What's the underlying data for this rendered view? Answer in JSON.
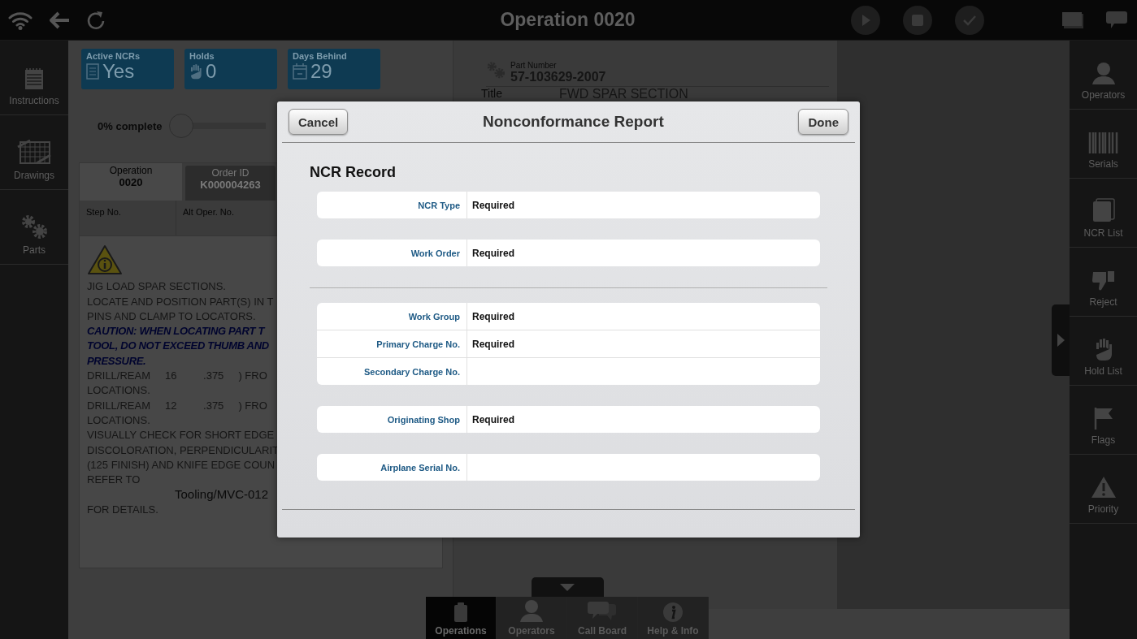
{
  "top_bar": {
    "title": "Operation 0020"
  },
  "left_nav": [
    {
      "label": "Instructions",
      "kind": "instructions"
    },
    {
      "label": "Drawings",
      "kind": "drawings"
    },
    {
      "label": "Parts",
      "kind": "parts"
    }
  ],
  "stats": [
    {
      "label": "Active NCRs",
      "value": "Yes",
      "kind": "ncr"
    },
    {
      "label": "Holds",
      "value": "0",
      "kind": "hold"
    },
    {
      "label": "Days Behind",
      "value": "29",
      "kind": "days"
    }
  ],
  "progress": {
    "label": "0% complete",
    "level": 0
  },
  "info_tabs": [
    {
      "label": "Operation",
      "value": "0020",
      "selected": true
    },
    {
      "label": "Order ID",
      "value": "K000004263",
      "selected": false
    }
  ],
  "info_fields": [
    "Step No.",
    "Alt Oper. No."
  ],
  "instructions": [
    {
      "text": "JIG LOAD SPAR SECTIONS.",
      "kind": "normal"
    },
    {
      "text": "LOCATE AND POSITION PART(S) IN T",
      "kind": "normal"
    },
    {
      "text": "PINS AND CLAMP TO LOCATORS.",
      "kind": "normal"
    },
    {
      "text": "CAUTION: WHEN LOCATING PART T",
      "kind": "caution"
    },
    {
      "text": "TOOL, DO NOT EXCEED THUMB AND",
      "kind": "caution"
    },
    {
      "text": "PRESSURE.",
      "kind": "caution"
    },
    {
      "text": "DRILL/REAM     16         .375     ) FRO",
      "kind": "normal"
    },
    {
      "text": "LOCATIONS.",
      "kind": "normal"
    },
    {
      "text": "DRILL/REAM     12         .375     ) FRO",
      "kind": "normal"
    },
    {
      "text": "LOCATIONS.",
      "kind": "normal"
    },
    {
      "text": "VISUALLY CHECK FOR SHORT EDGE",
      "kind": "normal"
    },
    {
      "text": "DISCOLORATION, PERPENDICULARIT",
      "kind": "normal"
    },
    {
      "text": "(125 FINISH) AND KNIFE EDGE COUN",
      "kind": "normal"
    },
    {
      "text": "REFER TO",
      "kind": "normal"
    },
    {
      "text": "Tooling/MVC-012",
      "kind": "reference"
    },
    {
      "text": "FOR DETAILS.",
      "kind": "normal"
    }
  ],
  "document": {
    "part_label": "Part Number",
    "part_number": "57-103629-2007",
    "title_label": "Title",
    "title": "FWD SPAR SECTION"
  },
  "right_nav": [
    {
      "label": "Operators",
      "kind": "person"
    },
    {
      "label": "Serials",
      "kind": "barcode"
    },
    {
      "label": "NCR List",
      "kind": "cards"
    },
    {
      "label": "Reject",
      "kind": "thumbdown"
    },
    {
      "label": "Hold List",
      "kind": "hand"
    },
    {
      "label": "Flags",
      "kind": "flag"
    },
    {
      "label": "Priority",
      "kind": "warning"
    }
  ],
  "bottom_bar": [
    {
      "label": "Operations",
      "kind": "clipboard",
      "selected": true
    },
    {
      "label": "Operators",
      "kind": "person",
      "selected": false
    },
    {
      "label": "Call Board",
      "kind": "chat",
      "selected": false
    },
    {
      "label": "Help & Info",
      "kind": "info",
      "selected": false
    }
  ],
  "dialog": {
    "title": "Nonconformance Report",
    "cancel": "Cancel",
    "done": "Done",
    "heading": "NCR Record",
    "sections": [
      {
        "groups": [
          [
            {
              "label": "NCR Type",
              "value": "Required"
            }
          ],
          [
            {
              "label": "Work Order",
              "value": "Required"
            }
          ]
        ]
      },
      {
        "groups": [
          [
            {
              "label": "Work Group",
              "value": "Required"
            },
            {
              "label": "Primary Charge No.",
              "value": "Required"
            },
            {
              "label": "Secondary Charge No."
            }
          ],
          [
            {
              "label": "Originating Shop",
              "value": "Required"
            }
          ],
          [
            {
              "label": "Airplane Serial No."
            }
          ]
        ]
      }
    ]
  }
}
